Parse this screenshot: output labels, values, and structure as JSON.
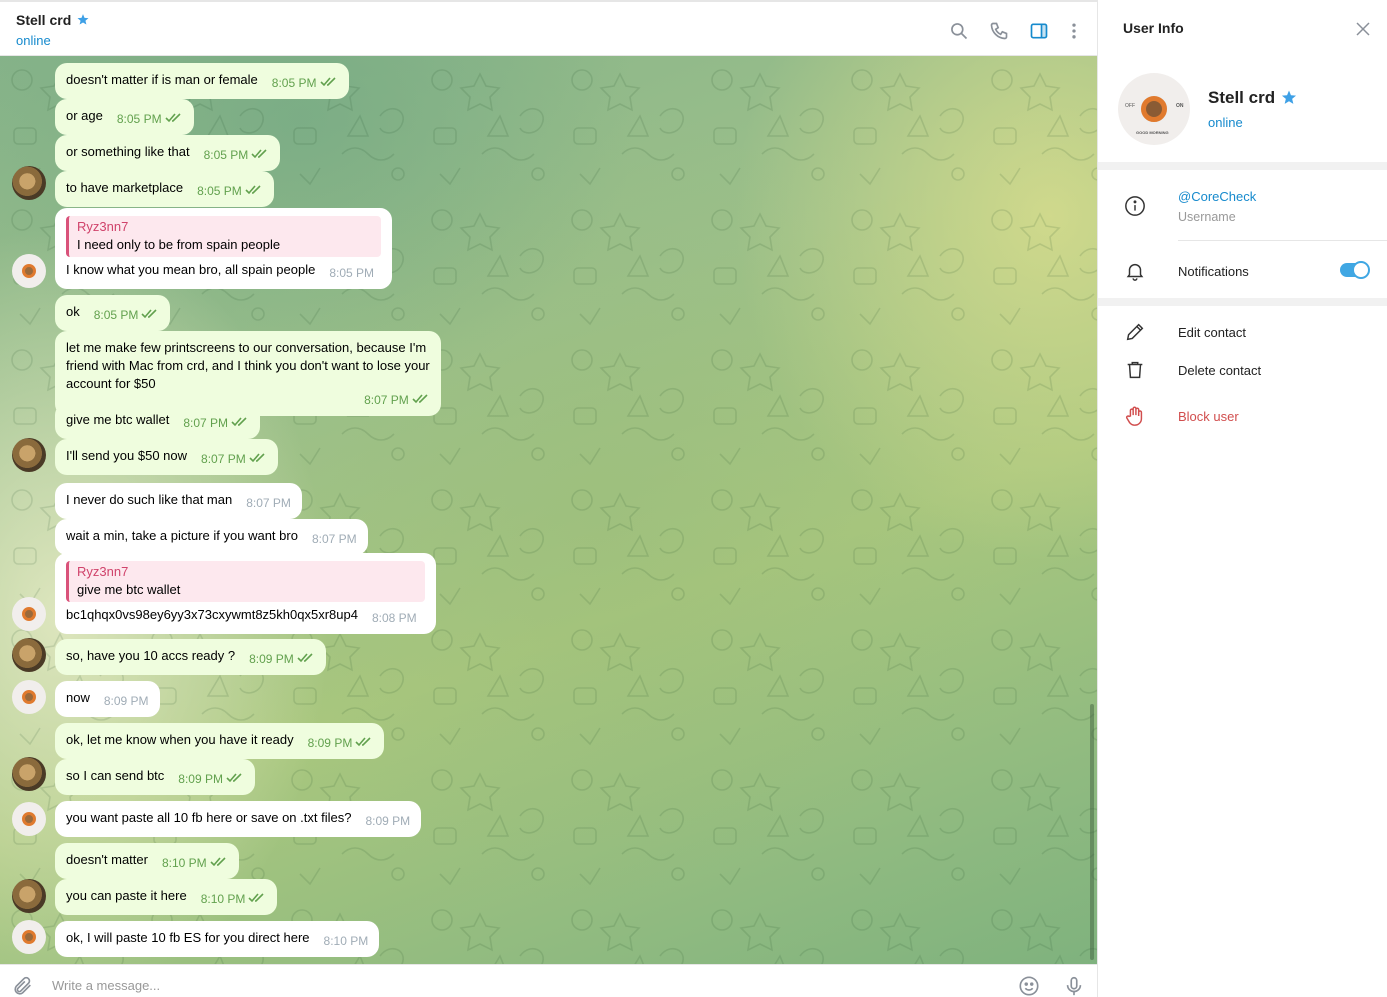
{
  "chat_header": {
    "title": "Stell crd",
    "status": "online",
    "verified_icon": "star-badge-icon",
    "accent_color": "#168acd"
  },
  "messages": [
    {
      "dir": "out",
      "text": "doesn't matter if is man or female",
      "time": "8:05 PM",
      "read": true
    },
    {
      "dir": "out",
      "text": "or age",
      "time": "8:05 PM",
      "read": true
    },
    {
      "dir": "out",
      "text": "or something like that",
      "time": "8:05 PM",
      "read": true
    },
    {
      "dir": "out",
      "text": "to have marketplace",
      "time": "8:05 PM",
      "read": true,
      "avatar": "coin"
    },
    {
      "dir": "in",
      "reply_name": "Ryz3nn7",
      "reply_text": "I need only to be from spain people",
      "text": "I know what you mean bro, all spain people",
      "time": "8:05 PM",
      "avatar": "logo"
    },
    {
      "dir": "out",
      "text": "ok",
      "time": "8:05 PM",
      "read": true
    },
    {
      "dir": "out",
      "lines": [
        "let me make few printscreens to our conversation, because I'm",
        "friend with Mac from crd, and I think you don't want to lose your",
        "account for $50"
      ],
      "time": "8:07 PM",
      "read": true
    },
    {
      "dir": "out",
      "text": "give me btc wallet",
      "time": "8:07 PM",
      "read": true
    },
    {
      "dir": "out",
      "text": "I'll send you $50 now",
      "time": "8:07 PM",
      "read": true,
      "avatar": "coin"
    },
    {
      "dir": "in",
      "text": "I never do such like that man",
      "time": "8:07 PM"
    },
    {
      "dir": "in",
      "text": "wait a min, take a picture if you want bro",
      "time": "8:07 PM"
    },
    {
      "dir": "in",
      "reply_name": "Ryz3nn7",
      "reply_text": "give me btc wallet",
      "text": "bc1qhqx0vs98ey6yy3x73cxywmt8z5kh0qx5xr8up4",
      "time": "8:08 PM",
      "avatar": "logo"
    },
    {
      "dir": "out",
      "text": "so, have you 10 accs ready ?",
      "time": "8:09 PM",
      "read": true,
      "avatar": "coin"
    },
    {
      "dir": "in",
      "text": "now",
      "time": "8:09 PM",
      "avatar": "logo"
    },
    {
      "dir": "out",
      "text": "ok, let me know when you have it ready",
      "time": "8:09 PM",
      "read": true
    },
    {
      "dir": "out",
      "text": "so I can send btc",
      "time": "8:09 PM",
      "read": true,
      "avatar": "coin"
    },
    {
      "dir": "in",
      "text": "you want paste all 10 fb here or save on .txt files?",
      "time": "8:09 PM",
      "avatar": "logo"
    },
    {
      "dir": "out",
      "text": "doesn't matter",
      "time": "8:10 PM",
      "read": true
    },
    {
      "dir": "out",
      "text": "you can paste it here",
      "time": "8:10 PM",
      "read": true,
      "avatar": "coin"
    },
    {
      "dir": "in",
      "text": "ok, I will paste 10 fb ES for you direct here",
      "time": "8:10 PM",
      "avatar": "logo"
    }
  ],
  "composer": {
    "placeholder": "Write a message..."
  },
  "user_info": {
    "title": "User Info",
    "name": "Stell crd",
    "status": "online",
    "avatar_text_left": "OFF",
    "avatar_text_right": "ON",
    "avatar_text_bottom": "GOOD MORNING",
    "username": "@CoreCheck",
    "username_label": "Username",
    "notifications_label": "Notifications",
    "notifications_enabled": true,
    "edit_contact": "Edit contact",
    "delete_contact": "Delete contact",
    "block_user": "Block user",
    "danger_color": "#d14e4e"
  }
}
